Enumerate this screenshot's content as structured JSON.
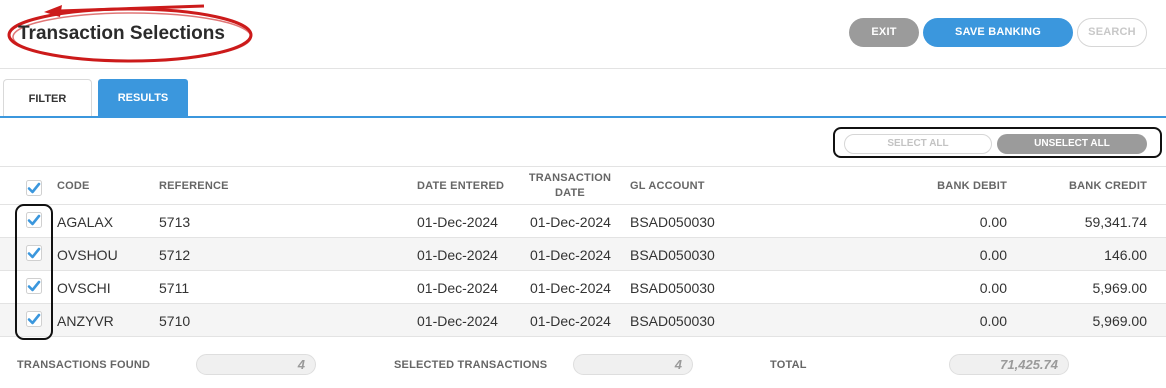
{
  "header": {
    "title": "Transaction Selections",
    "buttons": {
      "exit": "EXIT",
      "save": "SAVE BANKING",
      "search": "SEARCH"
    }
  },
  "tabs": [
    {
      "label": "FILTER",
      "active": false
    },
    {
      "label": "RESULTS",
      "active": true
    }
  ],
  "selection": {
    "select_all": "SELECT ALL",
    "unselect_all": "UNSELECT ALL"
  },
  "table": {
    "columns": {
      "code": "CODE",
      "reference": "REFERENCE",
      "date_entered": "DATE ENTERED",
      "transaction_date_line1": "TRANSACTION",
      "transaction_date_line2": "DATE",
      "gl_account": "GL ACCOUNT",
      "bank_debit": "BANK DEBIT",
      "bank_credit": "BANK CREDIT"
    },
    "header_checked": true,
    "rows": [
      {
        "checked": true,
        "code": "AGALAX",
        "reference": "5713",
        "date_entered": "01-Dec-2024",
        "transaction_date": "01-Dec-2024",
        "gl_account": "BSAD050030",
        "bank_debit": "0.00",
        "bank_credit": "59,341.74"
      },
      {
        "checked": true,
        "code": "OVSHOU",
        "reference": "5712",
        "date_entered": "01-Dec-2024",
        "transaction_date": "01-Dec-2024",
        "gl_account": "BSAD050030",
        "bank_debit": "0.00",
        "bank_credit": "146.00"
      },
      {
        "checked": true,
        "code": "OVSCHI",
        "reference": "5711",
        "date_entered": "01-Dec-2024",
        "transaction_date": "01-Dec-2024",
        "gl_account": "BSAD050030",
        "bank_debit": "0.00",
        "bank_credit": "5,969.00"
      },
      {
        "checked": true,
        "code": "ANZYVR",
        "reference": "5710",
        "date_entered": "01-Dec-2024",
        "transaction_date": "01-Dec-2024",
        "gl_account": "BSAD050030",
        "bank_debit": "0.00",
        "bank_credit": "5,969.00"
      }
    ]
  },
  "summary": {
    "transactions_found_label": "TRANSACTIONS FOUND",
    "transactions_found": "4",
    "selected_transactions_label": "SELECTED TRANSACTIONS",
    "selected_transactions": "4",
    "total_label": "TOTAL",
    "total": "71,425.74"
  },
  "colors": {
    "accent": "#3b97dd",
    "grey_button": "#9b9b9b",
    "annotation_red": "#cc1b1b",
    "annotation_black": "#111111"
  },
  "icons": [
    "checkmark-icon",
    "annotation-red-ellipse",
    "annotation-red-arrow"
  ]
}
